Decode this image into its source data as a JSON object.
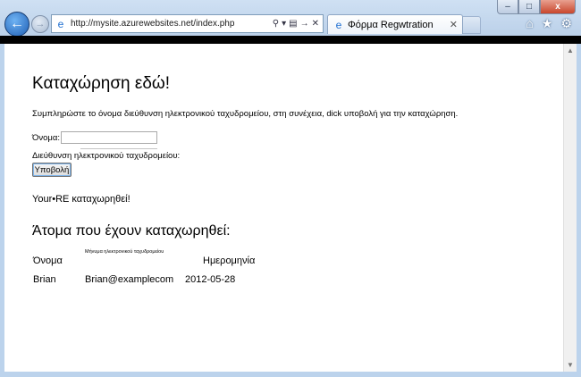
{
  "browser": {
    "address_url": "http://mysite.azurewebsites.net/index.php",
    "tab_title": "Φόρμα Regwtration",
    "window_controls": {
      "minimize": "–",
      "maximize": "□",
      "close": "x"
    },
    "right_icons": [
      "home-icon",
      "star-icon",
      "gear-icon"
    ]
  },
  "page": {
    "heading": "Καταχώρηση εδώ!",
    "instructions": "Συμπληρώστε το όνομα διεύθυνση ηλεκτρονικού ταχυδρομείου, στη συνέχεια, dick υποβολή για την καταχώρηση.",
    "form": {
      "name_label": "Όνομα:",
      "name_value": "",
      "email_label": "Διεύθυνση ηλεκτρονικού ταχυδρομείου:",
      "email_value": "",
      "submit_label": "Υποβολή"
    },
    "success_message": "Your•RE καταχωρηθεί!",
    "registrants_heading": "Άτομα που έχουν καταχωρηθεί:",
    "table": {
      "headers": [
        "Όνομα",
        "Μήνυμα ηλεκτρονικού ταχυδρομείου",
        "Ημερομηνία"
      ],
      "rows": [
        {
          "name": "Brian",
          "email": "Brian@examplecom",
          "date": "2012-05-28"
        }
      ]
    }
  }
}
